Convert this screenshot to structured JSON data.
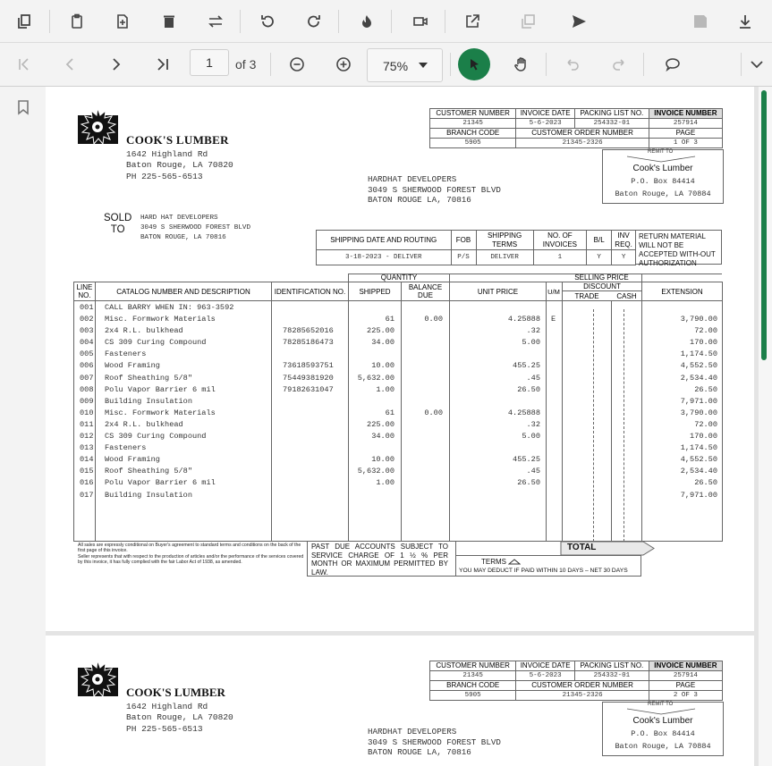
{
  "toolbar_top": {
    "icons": [
      "copy-icon",
      "paste-icon",
      "insert-page-icon",
      "delete-icon",
      "swap-icon",
      "undo-icon",
      "redo-icon",
      "burn-icon",
      "video-icon",
      "open-external-icon",
      "duplicate-icon",
      "send-icon",
      "save-icon",
      "download-icon"
    ]
  },
  "toolbar_nav": {
    "page_number": "1",
    "page_total": "of 3",
    "zoom": "75%"
  },
  "colors": {
    "accent": "#1b7f49",
    "toolbar_bg": "#f3f3f3",
    "page_bg": "#ffffff",
    "canvas_bg": "#e4e4e4"
  },
  "invoice": {
    "company": "COOK'S LUMBER",
    "address": [
      "1642 Highland Rd",
      "Baton Rouge, LA 70820",
      "PH 225-565-6513"
    ],
    "ship_to": [
      "HARDHAT DEVELOPERS",
      "3049 S SHERWOOD FOREST BLVD",
      "BATON ROUGE LA, 70816"
    ],
    "sold_label": [
      "SOLD",
      "TO"
    ],
    "sold_to": [
      "HARD HAT DEVELOPERS",
      "3049 S SHERWOOD FOREST BLVD",
      "BATON ROUGE, LA 70816"
    ],
    "header": {
      "customer_number_label": "CUSTOMER NUMBER",
      "customer_number": "21345",
      "invoice_date_label": "INVOICE DATE",
      "invoice_date": "5-6-2023",
      "packing_list_label": "PACKING LIST NO.",
      "packing_list": "254332-01",
      "invoice_number_label": "INVOICE NUMBER",
      "invoice_number": "257914",
      "branch_code_label": "BRANCH CODE",
      "branch_code": "5905",
      "customer_order_label": "CUSTOMER ORDER NUMBER",
      "customer_order": "21345-2326",
      "page_label": "PAGE",
      "page": "1 OF 3"
    },
    "remit": {
      "label": "REMIT TO",
      "name": "Cook's Lumber",
      "line1": "P.O. Box 84414",
      "line2": "Baton Rouge, LA 70884"
    },
    "shipping": {
      "h_date": "SHIPPING DATE AND ROUTING",
      "h_fob": "FOB",
      "h_terms": "SHIPPING TERMS",
      "h_invoices": "NO. OF INVOICES",
      "h_bl": "B/L",
      "h_inv": "INV REQ.",
      "date": "3-18-2023 - DELIVER",
      "fob": "P/S",
      "terms": "DELIVER",
      "invoices": "1",
      "bl": "Y",
      "inv": "Y",
      "return_note": "RETURN MATERIAL WILL NOT BE ACCEPTED WITH-OUT AUTHORIZATION"
    },
    "columns": {
      "line": "LINE NO.",
      "catalog": "CATALOG NUMBER AND DESCRIPTION",
      "ident": "IDENTIFICATION NO.",
      "quantity": "QUANTITY",
      "shipped": "SHIPPED",
      "balance": "BALANCE DUE",
      "unit_price": "UNIT PRICE",
      "um": "U/M",
      "selling_price": "SELLING PRICE",
      "discount": "DISCOUNT",
      "trade": "TRADE",
      "cash": "CASH",
      "extension": "EXTENSION"
    },
    "items": [
      {
        "line": "001",
        "desc": "CALL BARRY WHEN IN: 963-3592",
        "id": "",
        "shipped": "",
        "balance": "",
        "price": "",
        "um": "",
        "ext": ""
      },
      {
        "line": "002",
        "desc": "Misc. Formwork Materials",
        "id": "",
        "shipped": "61",
        "balance": "0.00",
        "price": "4.25888",
        "um": "E",
        "ext": "3,790.00"
      },
      {
        "line": "003",
        "desc": "2x4 R.L. bulkhead",
        "id": "78285652016",
        "shipped": "225.00",
        "balance": "",
        "price": ".32",
        "um": "",
        "ext": "72.00"
      },
      {
        "line": "004",
        "desc": "CS 309 Curing Compound",
        "id": "78285186473",
        "shipped": "34.00",
        "balance": "",
        "price": "5.00",
        "um": "",
        "ext": "170.00"
      },
      {
        "line": "005",
        "desc": "Fasteners",
        "id": "",
        "shipped": "",
        "balance": "",
        "price": "",
        "um": "",
        "ext": "1,174.50"
      },
      {
        "line": "006",
        "desc": "Wood Framing",
        "id": "73618593751",
        "shipped": "10.00",
        "balance": "",
        "price": "455.25",
        "um": "",
        "ext": "4,552.50"
      },
      {
        "line": "007",
        "desc": "Roof Sheathing 5/8\"",
        "id": "75449381920",
        "shipped": "5,632.00",
        "balance": "",
        "price": ".45",
        "um": "",
        "ext": "2,534.40"
      },
      {
        "line": "008",
        "desc": "Polu Vapor Barrier 6 mil",
        "id": "79182631047",
        "shipped": "1.00",
        "balance": "",
        "price": "26.50",
        "um": "",
        "ext": "26.50"
      },
      {
        "line": "009",
        "desc": "Building Insulation",
        "id": "",
        "shipped": "",
        "balance": "",
        "price": "",
        "um": "",
        "ext": "7,971.00"
      },
      {
        "line": "010",
        "desc": "Misc. Formwork Materials",
        "id": "",
        "shipped": "61",
        "balance": "0.00",
        "price": "4.25888",
        "um": "",
        "ext": "3,790.00"
      },
      {
        "line": "011",
        "desc": "2x4 R.L. bulkhead",
        "id": "",
        "shipped": "225.00",
        "balance": "",
        "price": ".32",
        "um": "",
        "ext": "72.00"
      },
      {
        "line": "012",
        "desc": "CS 309 Curing Compound",
        "id": "",
        "shipped": "34.00",
        "balance": "",
        "price": "5.00",
        "um": "",
        "ext": "170.00"
      },
      {
        "line": "013",
        "desc": "Fasteners",
        "id": "",
        "shipped": "",
        "balance": "",
        "price": "",
        "um": "",
        "ext": "1,174.50"
      },
      {
        "line": "014",
        "desc": "Wood Framing",
        "id": "",
        "shipped": "10.00",
        "balance": "",
        "price": "455.25",
        "um": "",
        "ext": "4,552.50"
      },
      {
        "line": "015",
        "desc": "Roof Sheathing 5/8\"",
        "id": "",
        "shipped": "5,632.00",
        "balance": "",
        "price": ".45",
        "um": "",
        "ext": "2,534.40"
      },
      {
        "line": "016",
        "desc": "Polu Vapor Barrier 6 mil",
        "id": "",
        "shipped": "1.00",
        "balance": "",
        "price": "26.50",
        "um": "",
        "ext": "26.50"
      },
      {
        "line": "017",
        "desc": "Building Insulation",
        "id": "",
        "shipped": "",
        "balance": "",
        "price": "",
        "um": "",
        "ext": "7,971.00"
      }
    ],
    "footer": {
      "legal": "All sales are expressly conditional on Buyer's agreement to standard terms and conditions on the back of the first page of this invoice.\nSeller represents that with respect to the production of articles and/or the performance of the services covered by this invoice, it has fully complied with the fair Labor Act of 1938, as amended.",
      "past_due": "PAST DUE ACCOUNTS SUBJECT TO SERVICE CHARGE OF 1 ½ % PER MONTH OR MAXIMUM PERMITTED BY LAW.",
      "terms_label": "TERMS",
      "terms_text": "YOU MAY DEDUCT IF PAID WITHIN 10 DAYS – NET 30 DAYS",
      "total_label": "TOTAL"
    }
  },
  "page2": {
    "page": "2 OF 3"
  }
}
